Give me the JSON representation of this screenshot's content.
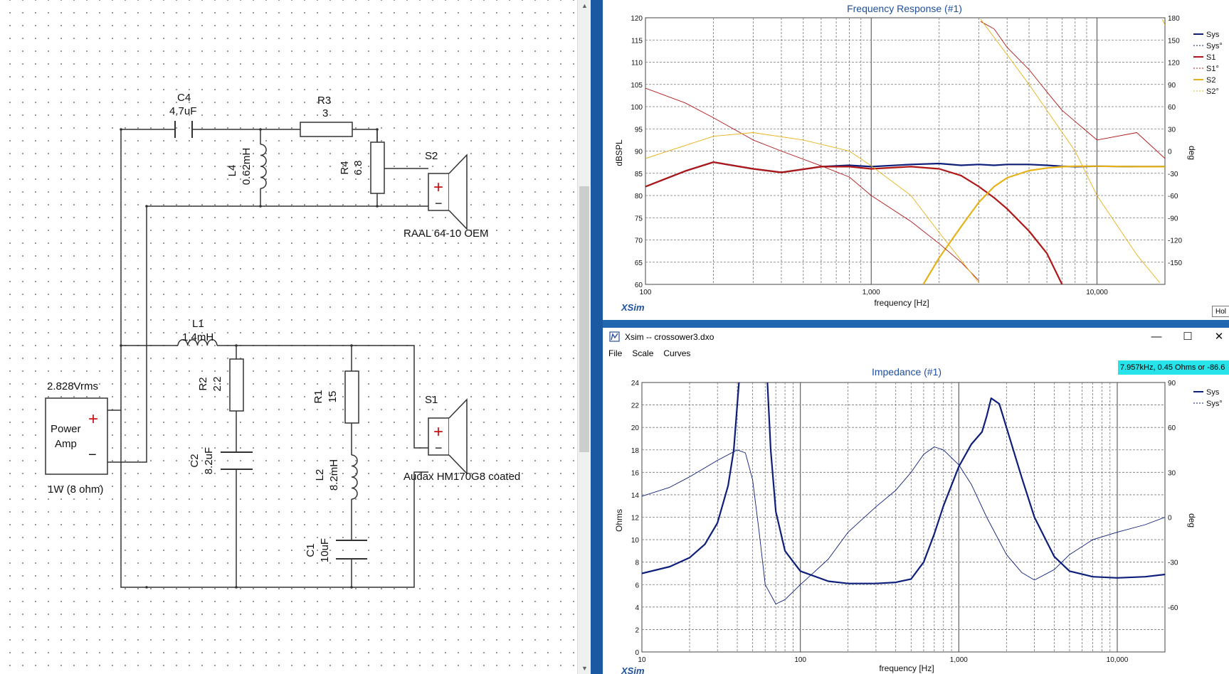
{
  "schematic": {
    "power_amp": {
      "voltage": "2.828Vrms",
      "line1": "Power",
      "line2": "Amp",
      "plus": "+",
      "minus": "−",
      "rating": "1W (8 ohm)"
    },
    "components": {
      "c4": {
        "name": "C4",
        "value": "4.7uF"
      },
      "r3": {
        "name": "R3",
        "value": "3"
      },
      "l4": {
        "name": "L4",
        "value": "0.62mH"
      },
      "r4": {
        "name": "R4",
        "value": "6.8"
      },
      "s2": {
        "name": "S2",
        "model": "RAAL 64-10 OEM"
      },
      "l1": {
        "name": "L1",
        "value": "1.4mH"
      },
      "r2": {
        "name": "R2",
        "value": "2.2"
      },
      "c2": {
        "name": "C2",
        "value": "8.2uF"
      },
      "r1": {
        "name": "R1",
        "value": "15"
      },
      "l2": {
        "name": "L2",
        "value": "8.2mH"
      },
      "c1": {
        "name": "C1",
        "value": "10uF"
      },
      "s1": {
        "name": "S1",
        "model": "Audax HM170G8 coated"
      }
    },
    "speaker_plus": "+",
    "speaker_minus": "−"
  },
  "freq_response": {
    "title": "Frequency Response (#1)",
    "xlabel": "frequency [Hz]",
    "ylabel": "dBSPL",
    "y2label": "deg",
    "brand": "XSim",
    "hold_label": "Hol",
    "y_ticks": [
      "120",
      "115",
      "110",
      "105",
      "100",
      "95",
      "90",
      "85",
      "80",
      "75",
      "70",
      "65",
      "60"
    ],
    "y2_ticks": [
      "180",
      "150",
      "120",
      "90",
      "60",
      "30",
      "0",
      "-30",
      "-60",
      "-90",
      "-120",
      "-150"
    ],
    "x_ticks": [
      "100",
      "1,000",
      "10,000"
    ],
    "legend": [
      "Sys",
      "Sys°",
      "S1",
      "S1°",
      "S2",
      "S2°"
    ]
  },
  "impedance_window": {
    "title": "Xsim -- crossower3.dxo",
    "menu": [
      "File",
      "Scale",
      "Curves"
    ],
    "win_minimize": "—",
    "win_maximize": "☐",
    "win_close": "✕",
    "cursor_readout": "7.957kHz, 0.45 Ohms or -86.6",
    "chart_title": "Impedance (#1)",
    "xlabel": "frequency [Hz]",
    "ylabel": "Ohms",
    "y2label": "deg",
    "brand": "XSim",
    "y_ticks": [
      "24",
      "22",
      "20",
      "18",
      "16",
      "14",
      "12",
      "10",
      "8",
      "6",
      "4",
      "2",
      "0"
    ],
    "y2_ticks": [
      "90",
      "60",
      "30",
      "0",
      "-30",
      "-60"
    ],
    "x_ticks": [
      "10",
      "100",
      "1,000",
      "10,000"
    ],
    "legend": [
      "Sys",
      "Sys°"
    ]
  },
  "colors": {
    "sys": "#0d1f7a",
    "s1": "#b01818",
    "s2": "#e6b21a",
    "title": "#1f4fa0",
    "grid": "#6a6a6a"
  },
  "chart_data": [
    {
      "type": "line",
      "title": "Frequency Response (#1)",
      "xlabel": "frequency [Hz]",
      "ylabel": "dBSPL",
      "xscale": "log",
      "xlim": [
        100,
        20000
      ],
      "ylim": [
        60,
        120
      ],
      "y2lim": [
        -180,
        180
      ],
      "grid": true,
      "legend_position": "right",
      "series": [
        {
          "name": "Sys",
          "axis": "y",
          "color": "#0d1f7a",
          "x": [
            100,
            150,
            200,
            300,
            400,
            600,
            800,
            1000,
            1500,
            2000,
            2500,
            3000,
            3500,
            4000,
            5000,
            6000,
            7000,
            8000,
            10000,
            15000,
            20000
          ],
          "y": [
            82,
            85.5,
            87.5,
            86,
            85.2,
            86.5,
            86.8,
            86.5,
            87,
            87.2,
            86.8,
            87,
            86.8,
            87,
            87,
            86.8,
            86.6,
            86.5,
            86.6,
            86.5,
            86.5
          ]
        },
        {
          "name": "S1",
          "axis": "y",
          "color": "#b01818",
          "x": [
            100,
            150,
            200,
            300,
            400,
            600,
            800,
            1000,
            1500,
            2000,
            2500,
            3000,
            3500,
            4000,
            5000,
            6000,
            7000
          ],
          "y": [
            82,
            85.5,
            87.5,
            86,
            85.2,
            86.5,
            86.5,
            86,
            86.5,
            86,
            84.5,
            82,
            79.5,
            77,
            72,
            67,
            60
          ]
        },
        {
          "name": "S2",
          "axis": "y",
          "color": "#e6b21a",
          "x": [
            1700,
            2000,
            2500,
            3000,
            3500,
            4000,
            5000,
            6000,
            7000,
            8000,
            10000,
            15000,
            20000
          ],
          "y": [
            60,
            66,
            73,
            78.5,
            82,
            84,
            85.6,
            86.2,
            86.5,
            86.6,
            86.6,
            86.5,
            86.5
          ]
        },
        {
          "name": "S1°",
          "axis": "y2",
          "color": "#b01818",
          "x": [
            100,
            150,
            200,
            300,
            400,
            600,
            800,
            1000,
            1500,
            2000,
            2500,
            3000,
            3050,
            3500,
            4000,
            5000,
            6000,
            7000,
            8000,
            10000,
            15000,
            20000
          ],
          "y": [
            85,
            65,
            45,
            15,
            0,
            -20,
            -35,
            -60,
            -95,
            -125,
            -150,
            -175,
            175,
            165,
            140,
            110,
            80,
            55,
            40,
            15,
            25,
            -10
          ]
        },
        {
          "name": "S2°",
          "axis": "y2",
          "color": "#e6b21a",
          "x": [
            100,
            200,
            300,
            500,
            800,
            1000,
            1500,
            2000,
            3000,
            3050,
            4000,
            5000,
            6000,
            8000,
            10000,
            15000,
            19000,
            19500,
            20000
          ],
          "y": [
            -10,
            20,
            25,
            15,
            0,
            -20,
            -60,
            -110,
            -178,
            178,
            130,
            90,
            55,
            0,
            -60,
            -140,
            -178,
            178,
            170
          ]
        }
      ]
    },
    {
      "type": "line",
      "title": "Impedance (#1)",
      "xlabel": "frequency [Hz]",
      "ylabel": "Ohms",
      "xscale": "log",
      "xlim": [
        10,
        20000
      ],
      "ylim": [
        0,
        24
      ],
      "y2lim": [
        -90,
        90
      ],
      "grid": true,
      "legend_position": "right",
      "series": [
        {
          "name": "Sys",
          "axis": "y",
          "color": "#0d1f7a",
          "x": [
            10,
            15,
            20,
            25,
            30,
            35,
            38,
            41,
            43,
            45,
            60,
            62,
            65,
            70,
            80,
            100,
            150,
            200,
            300,
            400,
            500,
            600,
            700,
            800,
            1000,
            1200,
            1400,
            1500,
            1600,
            1800,
            2000,
            2500,
            3000,
            4000,
            5000,
            7000,
            10000,
            15000,
            20000
          ],
          "y": [
            7,
            7.6,
            8.4,
            9.6,
            11.5,
            14.8,
            18,
            24,
            24.5,
            24.5,
            24.5,
            24,
            18,
            12.5,
            9,
            7.2,
            6.3,
            6.1,
            6.1,
            6.2,
            6.5,
            8,
            10.5,
            13,
            16.5,
            18.5,
            19.6,
            21,
            22.6,
            22.1,
            20,
            15.5,
            12,
            8.5,
            7.2,
            6.7,
            6.6,
            6.7,
            6.9
          ]
        },
        {
          "name": "Sys°",
          "axis": "y2",
          "color": "#0d1f7a",
          "x": [
            10,
            15,
            20,
            30,
            40,
            45,
            50,
            55,
            60,
            70,
            80,
            100,
            150,
            200,
            300,
            400,
            500,
            600,
            700,
            800,
            1000,
            1200,
            1500,
            2000,
            2500,
            3000,
            4000,
            5000,
            7000,
            10000,
            15000,
            20000
          ],
          "y": [
            14,
            20,
            27,
            38,
            45,
            43,
            25,
            -10,
            -45,
            -58,
            -55,
            -45,
            -28,
            -10,
            7,
            18,
            30,
            42,
            47,
            45,
            35,
            22,
            0,
            -25,
            -37,
            -42,
            -35,
            -25,
            -15,
            -10,
            -5,
            0
          ]
        }
      ]
    }
  ]
}
